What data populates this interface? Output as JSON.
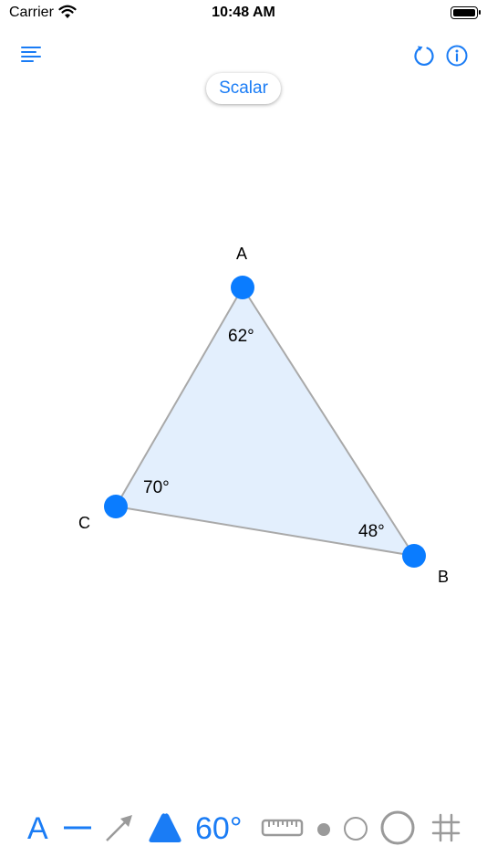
{
  "status_bar": {
    "carrier": "Carrier",
    "time": "10:48 AM"
  },
  "header": {
    "mode_label": "Scalar"
  },
  "triangle": {
    "vertices": [
      {
        "name": "A",
        "angle": "62°"
      },
      {
        "name": "B",
        "angle": "48°"
      },
      {
        "name": "C",
        "angle": "70°"
      }
    ]
  },
  "toolbar": {
    "label_tool": "A",
    "angle_tool": "60°"
  },
  "colors": {
    "accent": "#1a7cf5",
    "vertex_fill": "#0a7cff",
    "triangle_fill": "#e3effd",
    "edge_stroke": "#a9a9a9",
    "inactive_icon": "#9a9a9a"
  },
  "icons": {
    "menu": "menu-lines-icon",
    "reset": "rotate-icon",
    "info": "info-icon",
    "line_tool": "line-icon",
    "arrow_tool": "arrow-icon",
    "triangle_tool": "triangle-icon",
    "ruler_tool": "ruler-icon",
    "small_dot": "small-dot-icon",
    "medium_circle": "circle-icon",
    "large_circle": "circle-icon",
    "grid": "grid-icon"
  }
}
